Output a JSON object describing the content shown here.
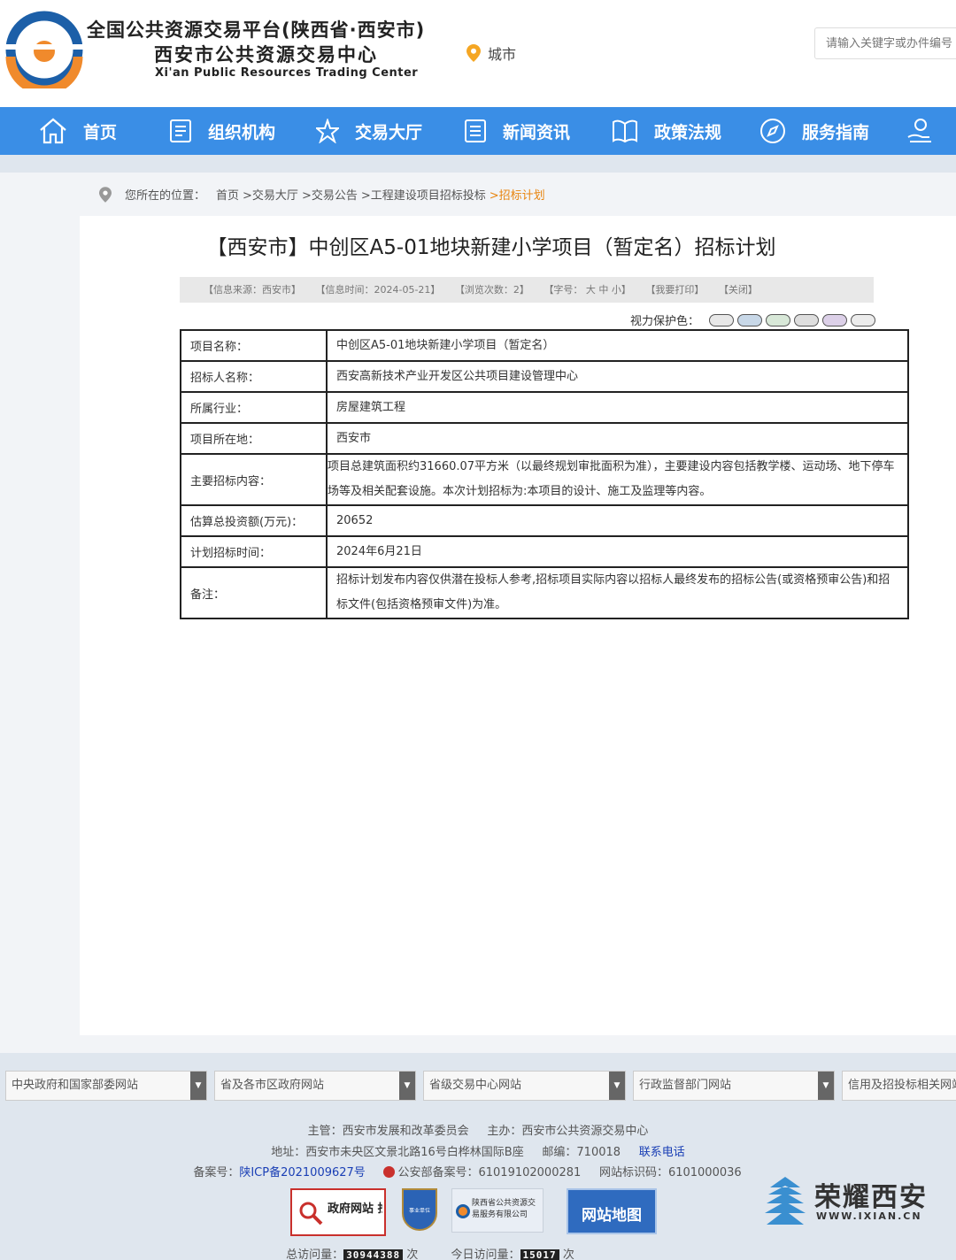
{
  "header": {
    "title_line1": "全国公共资源交易平台(陕西省·西安市)",
    "title_line2": "西安市公共资源交易中心",
    "title_en": "Xi'an Public Resources Trading Center",
    "city_label": "城市",
    "search_placeholder": "请输入关键字或办件编号"
  },
  "nav": [
    {
      "label": "首页",
      "icon": "home-icon"
    },
    {
      "label": "组织机构",
      "icon": "document-icon"
    },
    {
      "label": "交易大厅",
      "icon": "star-icon"
    },
    {
      "label": "新闻资讯",
      "icon": "list-icon"
    },
    {
      "label": "政策法规",
      "icon": "book-icon"
    },
    {
      "label": "服务指南",
      "icon": "compass-icon"
    },
    {
      "label": "",
      "icon": "service-hand-icon"
    }
  ],
  "breadcrumb": {
    "prefix": "您所在的位置：",
    "items": [
      "首页",
      ">交易大厅",
      ">交易公告",
      ">工程建设项目招标投标",
      ">招标计划"
    ]
  },
  "article": {
    "title": "【西安市】中创区A5-01地块新建小学项目（暂定名）招标计划",
    "meta": {
      "source": "【信息来源：西安市】",
      "time": "【信息时间：2024-05-21】",
      "views": "【浏览次数：2】",
      "font_size": "【字号： 大 中 小】",
      "print": "【我要打印】",
      "close": "【关闭】"
    },
    "vision_label": "视力保护色：",
    "vision_colors": [
      "#e8e8e8",
      "#c8d8e8",
      "#d8e8d8",
      "#dedede",
      "#dcd0e8",
      "#ececec"
    ],
    "rows": [
      {
        "key": "项目名称：",
        "value": "中创区A5-01地块新建小学项目（暂定名）"
      },
      {
        "key": "招标人名称：",
        "value": "西安高新技术产业开发区公共项目建设管理中心"
      },
      {
        "key": "所属行业：",
        "value": "房屋建筑工程"
      },
      {
        "key": "项目所在地：",
        "value": "西安市"
      },
      {
        "key": "主要招标内容：",
        "value": "项目总建筑面积约31660.07平方米（以最终规划审批面积为准），主要建设内容包括教学楼、运动场、地下停车场等及相关配套设施。本次计划招标为:本项目的设计、施工及监理等内容。"
      },
      {
        "key": "估算总投资额(万元)：",
        "value": "20652"
      },
      {
        "key": "计划招标时间：",
        "value": "2024年6月21日"
      },
      {
        "key": "备注：",
        "value": "招标计划发布内容仅供潜在投标人参考,招标项目实际内容以招标人最终发布的招标公告(或资格预审公告)和招标文件(包括资格预审文件)为准。"
      }
    ]
  },
  "footer": {
    "link_selects": [
      "中央政府和国家部委网站",
      "省及各市区政府网站",
      "省级交易中心网站",
      "行政监督部门网站",
      "信用及招投标相关网站"
    ],
    "sponsor": "主管：西安市发展和改革委员会",
    "host": "主办：西安市公共资源交易中心",
    "address": "地址：西安市未央区文景北路16号白桦林国际B座",
    "postcode": "邮编：710018",
    "contact": "联系电话",
    "icp_label": "备案号：",
    "icp": "陕ICP备2021009627号",
    "police": "公安部备案号：61019102000281",
    "site_id": "网站标识码：6101000036",
    "badges": [
      "政府网站 找错",
      "事业单位",
      "陕西省公共资源交易服务有限公司",
      "网站地图"
    ],
    "total_visits_label": "总访问量：",
    "total_visits": "30944388",
    "today_visits_label": "今日访问量：",
    "today_visits": "15017",
    "visits_unit": "次",
    "watermark_cn": "荣耀西安",
    "watermark_url": "WWW.IXIAN.CN"
  }
}
